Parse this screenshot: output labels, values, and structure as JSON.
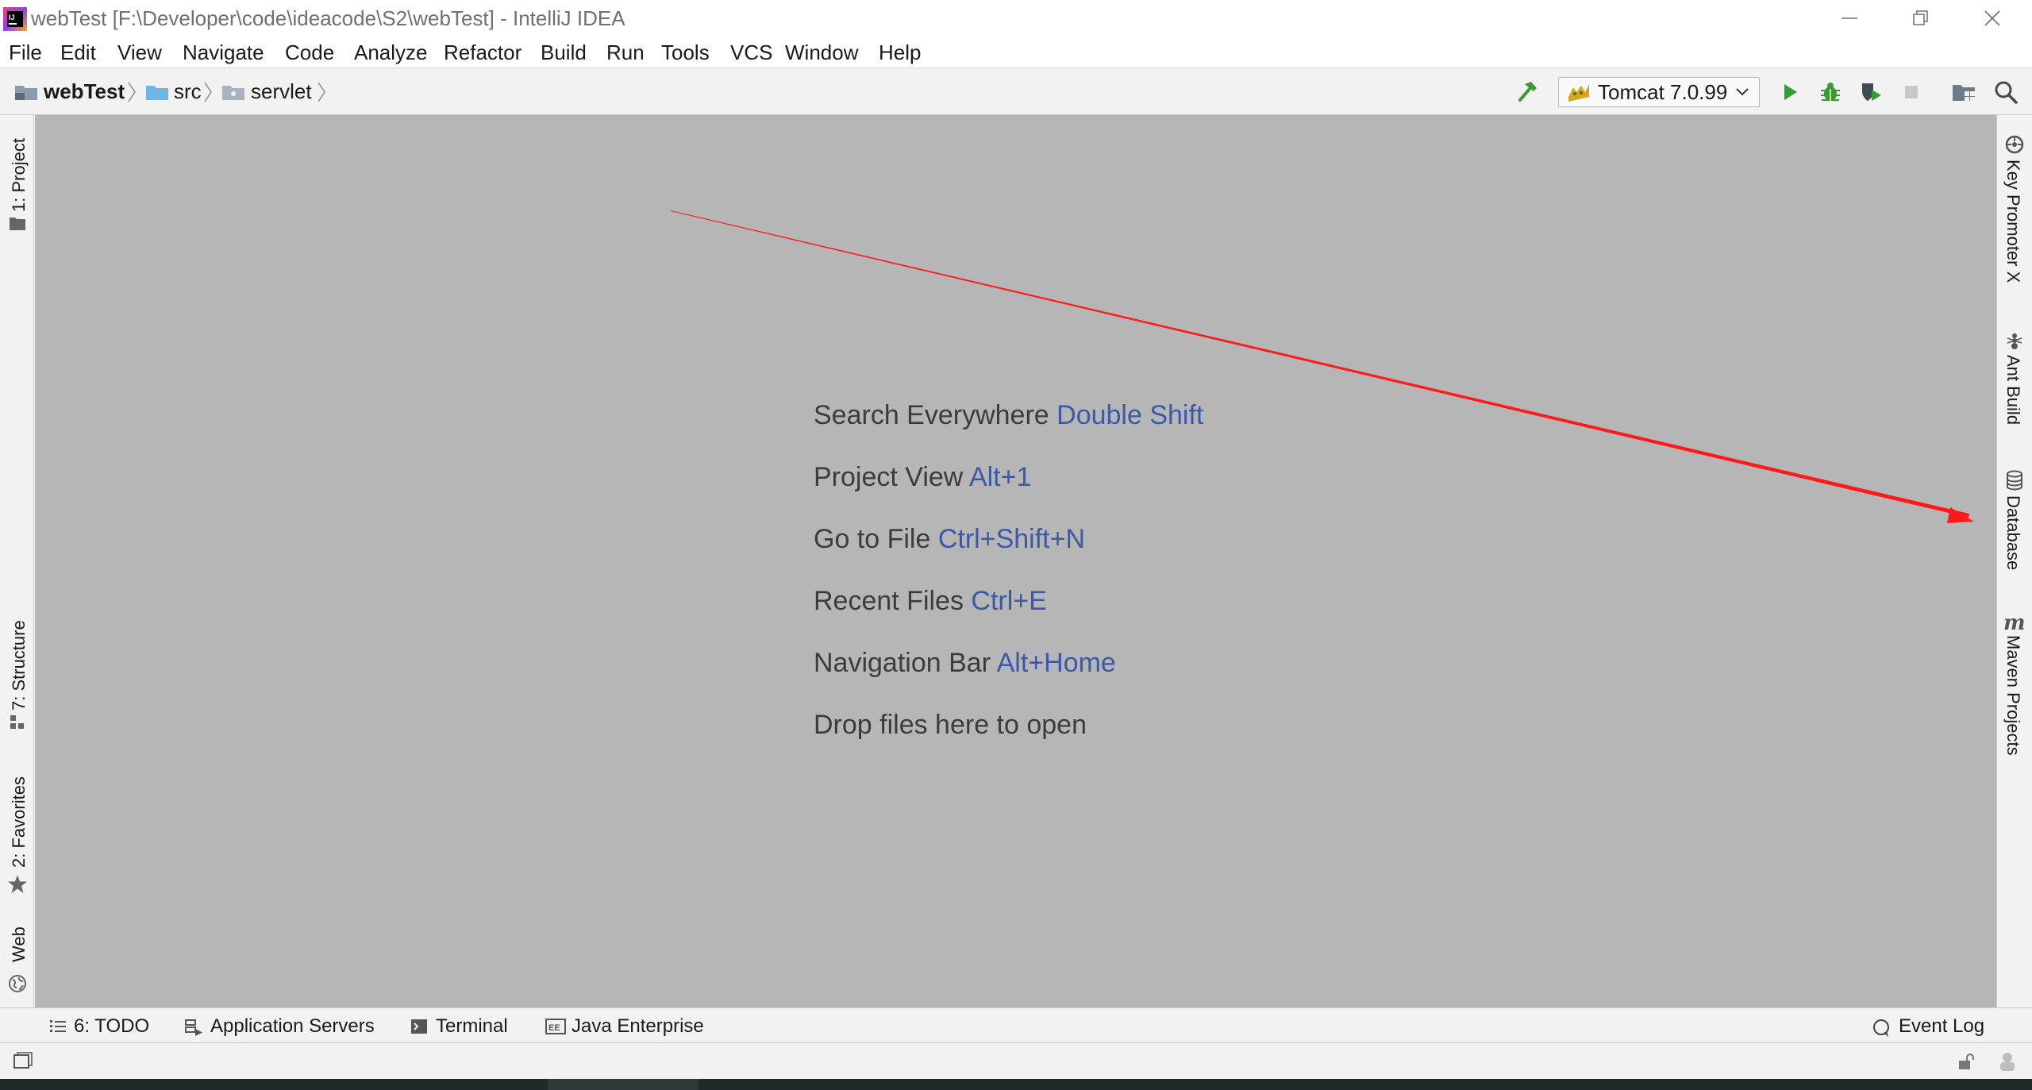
{
  "window": {
    "title": "webTest [F:\\Developer\\code\\ideacode\\S2\\webTest] - IntelliJ IDEA",
    "controls": [
      "minimize",
      "restore",
      "close"
    ]
  },
  "menu": [
    "File",
    "Edit",
    "View",
    "Navigate",
    "Code",
    "Analyze",
    "Refactor",
    "Build",
    "Run",
    "Tools",
    "VCS",
    "Window",
    "Help"
  ],
  "breadcrumb": {
    "project": "webTest",
    "folder1": "src",
    "folder2": "servlet"
  },
  "toolbar": {
    "run_config": "Tomcat 7.0.99"
  },
  "left_stripe": {
    "project": "1: Project",
    "structure": "7: Structure",
    "favorites": "2: Favorites",
    "web": "Web"
  },
  "right_stripe": {
    "key_promoter": "Key Promoter X",
    "ant_build": "Ant Build",
    "database": "Database",
    "maven": "Maven Projects"
  },
  "editor_hints": [
    {
      "text": "Search Everywhere",
      "key": "Double Shift"
    },
    {
      "text": "Project View",
      "key": "Alt+1"
    },
    {
      "text": "Go to File",
      "key": "Ctrl+Shift+N"
    },
    {
      "text": "Recent Files",
      "key": "Ctrl+E"
    },
    {
      "text": "Navigation Bar",
      "key": "Alt+Home"
    },
    {
      "text": "Drop files here to open",
      "key": ""
    }
  ],
  "bottom_tabs": {
    "todo": "6: TODO",
    "app_servers": "Application Servers",
    "terminal": "Terminal",
    "java_enterprise": "Java Enterprise",
    "event_log": "Event Log"
  },
  "colors": {
    "editor_bg": "#b6b6b6",
    "hint_key": "#3b59a8",
    "annotation_arrow": "#ff1a1a",
    "run_green": "#3a9a32"
  }
}
